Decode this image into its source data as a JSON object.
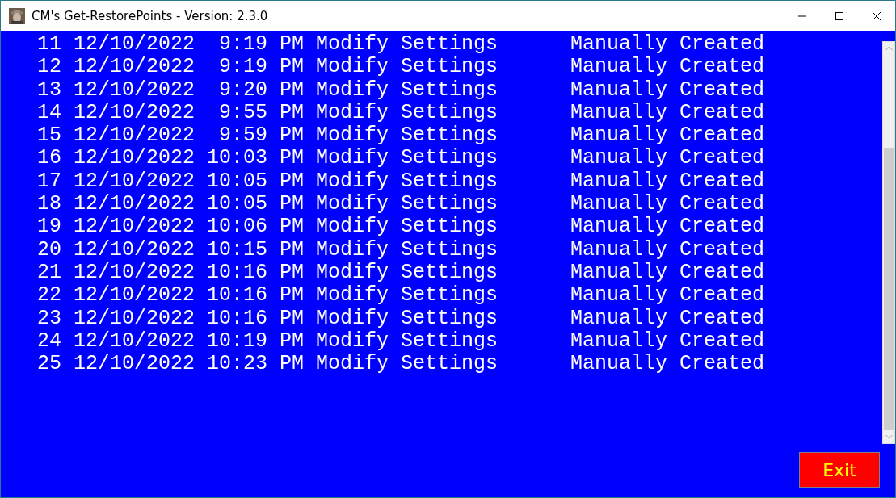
{
  "window": {
    "title": "CM's Get-RestorePoints - Version: 2.3.0"
  },
  "rows": [
    {
      "number": "11",
      "date": "12/10/2022",
      "time": "9:19",
      "ampm": "PM",
      "description": "Modify Settings",
      "type": "Manually Created"
    },
    {
      "number": "12",
      "date": "12/10/2022",
      "time": "9:19",
      "ampm": "PM",
      "description": "Modify Settings",
      "type": "Manually Created"
    },
    {
      "number": "13",
      "date": "12/10/2022",
      "time": "9:20",
      "ampm": "PM",
      "description": "Modify Settings",
      "type": "Manually Created"
    },
    {
      "number": "14",
      "date": "12/10/2022",
      "time": "9:55",
      "ampm": "PM",
      "description": "Modify Settings",
      "type": "Manually Created"
    },
    {
      "number": "15",
      "date": "12/10/2022",
      "time": "9:59",
      "ampm": "PM",
      "description": "Modify Settings",
      "type": "Manually Created"
    },
    {
      "number": "16",
      "date": "12/10/2022",
      "time": "10:03",
      "ampm": "PM",
      "description": "Modify Settings",
      "type": "Manually Created"
    },
    {
      "number": "17",
      "date": "12/10/2022",
      "time": "10:05",
      "ampm": "PM",
      "description": "Modify Settings",
      "type": "Manually Created"
    },
    {
      "number": "18",
      "date": "12/10/2022",
      "time": "10:05",
      "ampm": "PM",
      "description": "Modify Settings",
      "type": "Manually Created"
    },
    {
      "number": "19",
      "date": "12/10/2022",
      "time": "10:06",
      "ampm": "PM",
      "description": "Modify Settings",
      "type": "Manually Created"
    },
    {
      "number": "20",
      "date": "12/10/2022",
      "time": "10:15",
      "ampm": "PM",
      "description": "Modify Settings",
      "type": "Manually Created"
    },
    {
      "number": "21",
      "date": "12/10/2022",
      "time": "10:16",
      "ampm": "PM",
      "description": "Modify Settings",
      "type": "Manually Created"
    },
    {
      "number": "22",
      "date": "12/10/2022",
      "time": "10:16",
      "ampm": "PM",
      "description": "Modify Settings",
      "type": "Manually Created"
    },
    {
      "number": "23",
      "date": "12/10/2022",
      "time": "10:16",
      "ampm": "PM",
      "description": "Modify Settings",
      "type": "Manually Created"
    },
    {
      "number": "24",
      "date": "12/10/2022",
      "time": "10:19",
      "ampm": "PM",
      "description": "Modify Settings",
      "type": "Manually Created"
    },
    {
      "number": "25",
      "date": "12/10/2022",
      "time": "10:23",
      "ampm": "PM",
      "description": "Modify Settings",
      "type": "Manually Created"
    }
  ],
  "exit_button": {
    "label": "Exit"
  }
}
